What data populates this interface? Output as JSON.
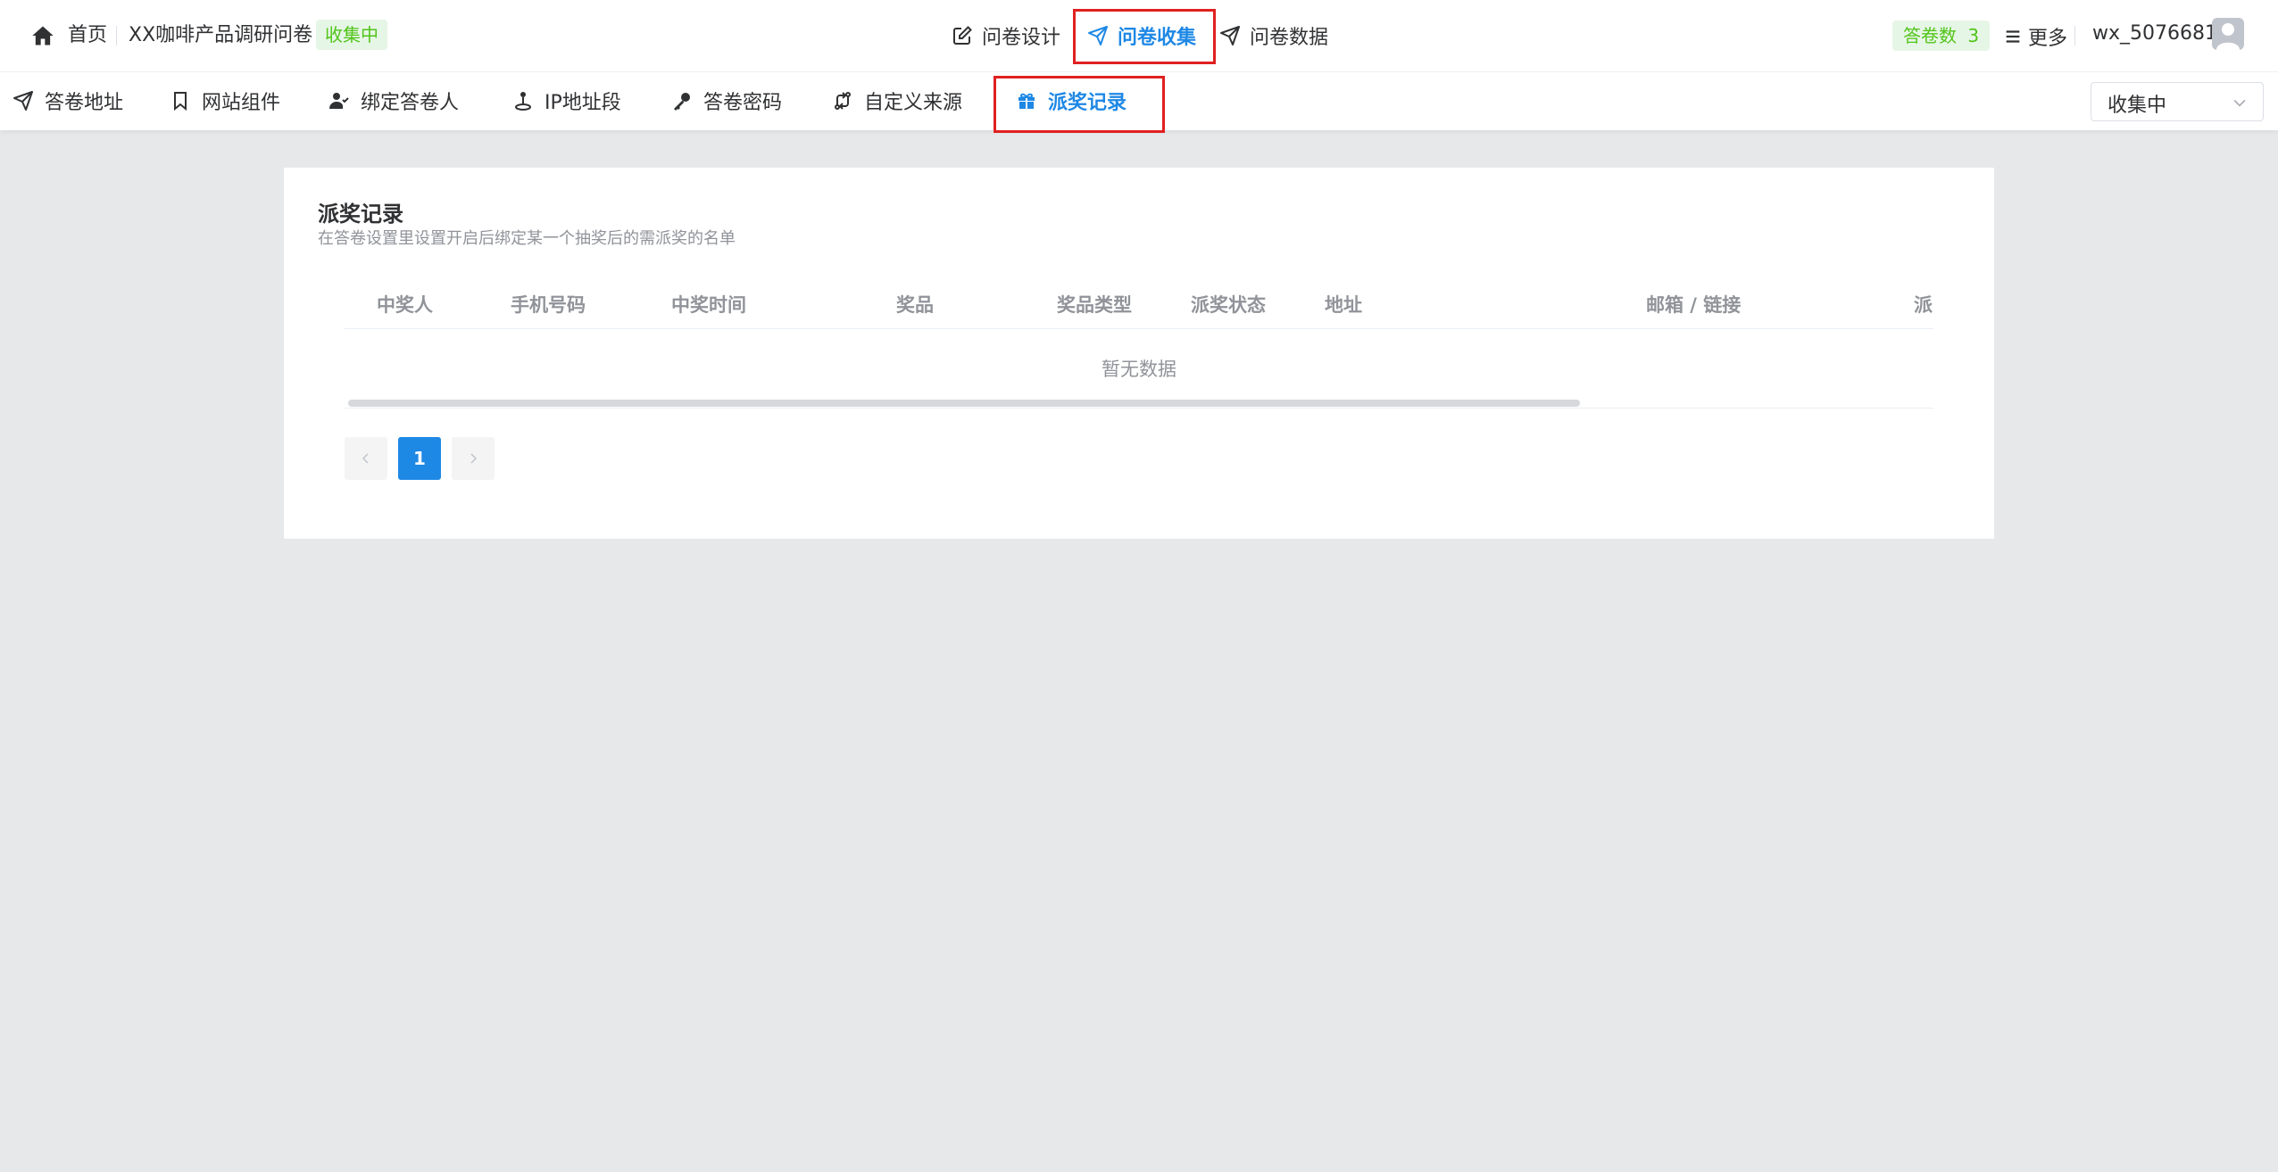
{
  "header": {
    "home_label": "首页",
    "survey_title": "XX咖啡产品调研问卷",
    "status_tag": "收集中",
    "tabs": [
      {
        "label": "问卷设计",
        "icon": "edit-icon"
      },
      {
        "label": "问卷收集",
        "icon": "send-icon",
        "active": true
      },
      {
        "label": "问卷数据",
        "icon": "send-icon"
      }
    ],
    "answer_count_label": "答卷数",
    "answer_count_value": "3",
    "more_label": "更多",
    "username": "wx_5076681"
  },
  "subnav": {
    "tabs": [
      {
        "label": "答卷地址",
        "icon": "send-icon"
      },
      {
        "label": "网站组件",
        "icon": "bookmark-icon"
      },
      {
        "label": "绑定答卷人",
        "icon": "user-check-icon"
      },
      {
        "label": "IP地址段",
        "icon": "location-icon"
      },
      {
        "label": "答卷密码",
        "icon": "key-icon"
      },
      {
        "label": "自定义来源",
        "icon": "swap-icon"
      },
      {
        "label": "派奖记录",
        "icon": "gift-icon",
        "active": true
      }
    ],
    "status_select": "收集中"
  },
  "card": {
    "title": "派奖记录",
    "subtitle": "在答卷设置里设置开启后绑定某一个抽奖后的需派奖的名单",
    "columns": [
      "中奖人",
      "手机号码",
      "中奖时间",
      "奖品",
      "奖品类型",
      "派奖状态",
      "地址",
      "邮箱 / 链接",
      "派"
    ],
    "empty_text": "暂无数据",
    "pagination": {
      "current_page": "1"
    }
  },
  "colors": {
    "accent": "#1e88e5",
    "highlight_box": "#e02020",
    "status_green": "#52c41a",
    "page_bg": "#e7e8ea"
  }
}
